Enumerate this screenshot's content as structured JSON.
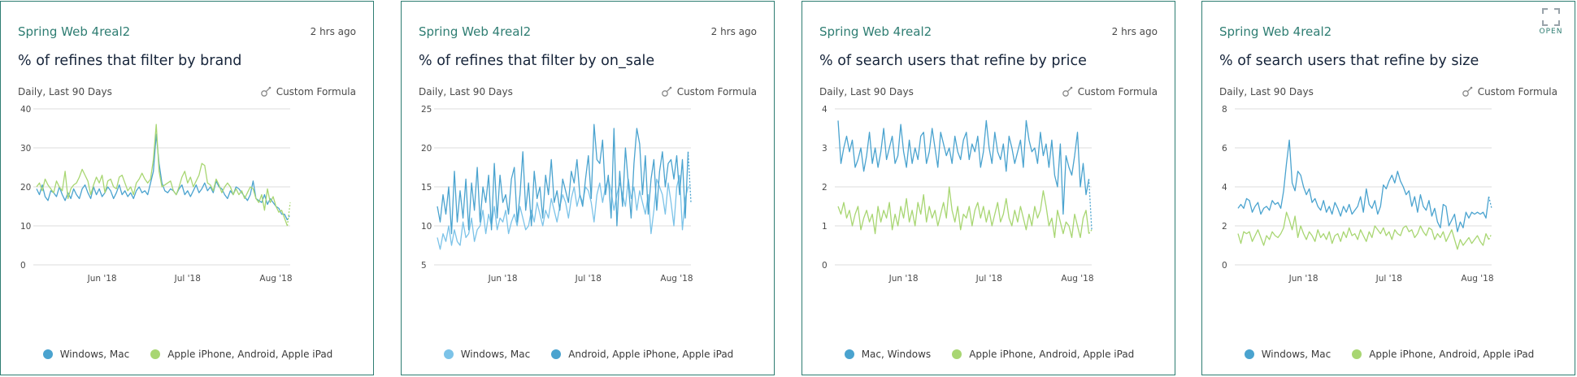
{
  "colors": {
    "blue": "#4aa3cf",
    "green": "#a8d672",
    "border": "#2e7d72"
  },
  "open_label": "OPEN",
  "open_icon": "expand-icon",
  "cards": [
    {
      "source": "Spring Web 4real2",
      "age": "2 hrs ago",
      "title": "% of refines that filter by brand",
      "range": "Daily, Last 90 Days",
      "formula_label": "Custom Formula",
      "formula_icon": "formula-icon",
      "legend": [
        {
          "label": "Windows, Mac",
          "color": "#4aa3cf"
        },
        {
          "label": "Apple iPhone, Android, Apple iPad",
          "color": "#a8d672"
        }
      ],
      "chart_data": {
        "type": "line",
        "ylim": [
          0,
          40
        ],
        "yticks": [
          "0",
          "10",
          "20",
          "30",
          "40"
        ],
        "xticks": [
          {
            "label": "Jun '18",
            "day": 23
          },
          {
            "label": "Jul '18",
            "day": 53
          },
          {
            "label": "Aug '18",
            "day": 84
          }
        ],
        "series": [
          {
            "name": "Windows, Mac",
            "color": "#4aa3cf",
            "values": [
              19.5,
              18.0,
              20.5,
              17.5,
              16.5,
              19.0,
              18.5,
              17.5,
              20.0,
              18.0,
              16.5,
              18.5,
              17.0,
              19.5,
              18.0,
              17.0,
              19.5,
              20.5,
              18.5,
              17.0,
              20.0,
              18.0,
              19.5,
              17.5,
              18.5,
              20.0,
              19.0,
              17.0,
              18.5,
              20.5,
              18.0,
              19.0,
              17.5,
              18.5,
              17.0,
              19.0,
              20.0,
              18.5,
              19.0,
              18.0,
              21.0,
              24.0,
              33.5,
              26.0,
              21.0,
              19.0,
              18.5,
              19.5,
              19.0,
              18.0,
              19.5,
              20.5,
              18.0,
              19.0,
              17.5,
              19.0,
              20.5,
              18.5,
              19.5,
              21.0,
              19.0,
              20.0,
              18.5,
              21.5,
              20.0,
              19.5,
              18.0,
              17.0,
              19.0,
              18.0,
              20.0,
              19.5,
              18.5,
              17.5,
              16.5,
              18.0,
              21.5,
              17.0,
              16.5,
              16.0,
              18.0,
              15.5,
              17.0,
              16.0,
              15.0,
              14.5,
              13.0,
              13.0,
              11.5,
              13.0
            ]
          },
          {
            "name": "Apple iPhone, Android, Apple iPad",
            "color": "#a8d672",
            "values": [
              20.0,
              21.0,
              19.0,
              22.0,
              20.5,
              19.5,
              18.5,
              21.5,
              20.0,
              19.0,
              24.0,
              17.0,
              19.5,
              20.5,
              21.0,
              22.5,
              24.5,
              23.0,
              21.5,
              18.0,
              20.5,
              22.5,
              21.0,
              23.0,
              18.5,
              21.5,
              22.0,
              20.0,
              19.5,
              22.5,
              23.0,
              21.0,
              19.0,
              20.0,
              18.0,
              21.0,
              22.0,
              23.5,
              22.0,
              21.0,
              22.0,
              27.0,
              36.0,
              24.0,
              20.0,
              20.5,
              21.0,
              21.5,
              19.0,
              18.0,
              20.0,
              22.5,
              24.0,
              21.0,
              22.5,
              20.0,
              21.5,
              23.0,
              26.0,
              25.5,
              21.0,
              20.5,
              19.0,
              22.0,
              20.5,
              18.5,
              20.0,
              21.0,
              20.0,
              18.0,
              19.5,
              18.0,
              19.0,
              17.0,
              18.5,
              20.0,
              19.5,
              17.0,
              16.0,
              18.0,
              14.0,
              19.5,
              16.0,
              17.5,
              15.0,
              13.5,
              14.0,
              12.0,
              10.0,
              16.0
            ]
          }
        ]
      }
    },
    {
      "source": "Spring Web 4real2",
      "age": "2 hrs ago",
      "title": "% of refines that filter by on_sale",
      "range": "Daily, Last 90 Days",
      "formula_label": "Custom Formula",
      "formula_icon": "formula-icon",
      "legend": [
        {
          "label": "Windows, Mac",
          "color": "#7cc3e8"
        },
        {
          "label": "Android, Apple iPhone, Apple iPad",
          "color": "#4aa3cf"
        }
      ],
      "chart_data": {
        "type": "line",
        "ylim": [
          5,
          25
        ],
        "yticks": [
          "5",
          "10",
          "15",
          "20",
          "25"
        ],
        "xticks": [
          {
            "label": "Jun '18",
            "day": 23
          },
          {
            "label": "Jul '18",
            "day": 53
          },
          {
            "label": "Aug '18",
            "day": 84
          }
        ],
        "series": [
          {
            "name": "Windows, Mac",
            "color": "#7cc3e8",
            "values": [
              8.5,
              7.0,
              9.0,
              8.0,
              10.0,
              7.5,
              9.5,
              8.0,
              7.5,
              10.5,
              8.5,
              9.0,
              11.0,
              8.0,
              9.5,
              10.0,
              12.0,
              9.0,
              11.5,
              10.0,
              12.5,
              9.5,
              11.0,
              10.5,
              12.0,
              9.0,
              10.5,
              11.5,
              10.0,
              12.5,
              11.0,
              9.5,
              10.0,
              12.0,
              10.5,
              13.0,
              11.5,
              10.0,
              12.0,
              11.0,
              13.5,
              12.0,
              10.5,
              12.5,
              14.0,
              13.0,
              11.0,
              13.5,
              15.0,
              12.5,
              14.0,
              13.0,
              15.0,
              14.5,
              13.0,
              10.5,
              14.0,
              15.5,
              13.0,
              15.0,
              16.0,
              14.5,
              12.0,
              14.0,
              15.5,
              14.0,
              12.5,
              16.0,
              13.5,
              15.0,
              12.0,
              14.5,
              13.0,
              11.5,
              14.0,
              9.0,
              12.0,
              16.0,
              15.0,
              14.0,
              11.5,
              15.5,
              13.0,
              10.0,
              15.0,
              16.5,
              9.5,
              13.5,
              15.0,
              15.0
            ]
          },
          {
            "name": "Android, Apple iPhone, Apple iPad",
            "color": "#4aa3cf",
            "values": [
              12.5,
              10.5,
              14.0,
              11.5,
              15.0,
              9.0,
              17.0,
              10.5,
              14.5,
              11.0,
              16.0,
              9.5,
              15.5,
              12.0,
              17.5,
              10.5,
              15.0,
              13.0,
              16.5,
              9.5,
              18.0,
              11.0,
              16.5,
              13.0,
              14.0,
              11.5,
              16.0,
              17.5,
              10.5,
              14.0,
              19.5,
              12.0,
              15.5,
              10.0,
              17.0,
              13.5,
              15.0,
              11.0,
              16.5,
              14.0,
              18.5,
              13.0,
              14.5,
              12.0,
              16.0,
              14.5,
              13.0,
              17.0,
              15.5,
              18.5,
              14.0,
              12.5,
              16.0,
              19.0,
              13.5,
              23.0,
              18.5,
              18.0,
              21.0,
              14.0,
              16.5,
              11.0,
              22.5,
              10.0,
              17.0,
              12.5,
              20.0,
              15.5,
              11.0,
              18.0,
              22.5,
              20.5,
              14.0,
              19.0,
              11.5,
              16.0,
              18.5,
              12.0,
              17.0,
              19.5,
              15.0,
              18.0,
              18.5,
              16.0,
              19.0,
              14.0,
              18.5,
              11.0,
              19.5,
              13.0
            ]
          }
        ]
      }
    },
    {
      "source": "Spring Web 4real2",
      "age": "2 hrs ago",
      "title": "% of search users that refine by price",
      "range": "Daily, Last 90 Days",
      "formula_label": "Custom Formula",
      "formula_icon": "formula-icon",
      "legend": [
        {
          "label": "Mac, Windows",
          "color": "#4aa3cf"
        },
        {
          "label": "Apple iPhone, Android, Apple iPad",
          "color": "#a8d672"
        }
      ],
      "chart_data": {
        "type": "line",
        "ylim": [
          0,
          4
        ],
        "yticks": [
          "0",
          "1",
          "2",
          "3",
          "4"
        ],
        "xticks": [
          {
            "label": "Jun '18",
            "day": 23
          },
          {
            "label": "Jul '18",
            "day": 53
          },
          {
            "label": "Aug '18",
            "day": 84
          }
        ],
        "series": [
          {
            "name": "Mac, Windows",
            "color": "#4aa3cf",
            "values": [
              3.7,
              2.6,
              3.0,
              3.3,
              2.9,
              3.2,
              2.5,
              2.7,
              3.0,
              2.4,
              2.8,
              3.4,
              2.6,
              3.0,
              2.5,
              2.9,
              3.5,
              2.7,
              3.0,
              3.3,
              2.6,
              2.8,
              3.6,
              2.9,
              2.5,
              3.2,
              2.6,
              3.0,
              2.7,
              3.3,
              3.4,
              2.6,
              2.9,
              3.5,
              3.0,
              2.5,
              3.4,
              3.1,
              2.8,
              3.0,
              2.6,
              3.3,
              2.9,
              2.7,
              3.2,
              3.4,
              2.7,
              3.1,
              2.9,
              3.3,
              2.5,
              2.9,
              3.7,
              3.0,
              2.6,
              3.4,
              2.9,
              2.7,
              3.1,
              2.4,
              3.3,
              3.0,
              2.6,
              2.9,
              3.2,
              2.5,
              3.7,
              3.2,
              2.9,
              3.0,
              2.6,
              3.4,
              2.8,
              3.1,
              2.5,
              3.2,
              2.3,
              2.0,
              3.1,
              1.3,
              2.8,
              2.5,
              2.3,
              2.8,
              3.4,
              2.0,
              2.6,
              1.8,
              2.2,
              0.9
            ]
          },
          {
            "name": "Apple iPhone, Android, Apple iPad",
            "color": "#a8d672",
            "values": [
              1.5,
              1.3,
              1.6,
              1.2,
              1.4,
              1.0,
              1.3,
              1.5,
              0.9,
              1.2,
              1.4,
              1.1,
              1.3,
              0.8,
              1.5,
              1.1,
              1.4,
              1.2,
              1.6,
              0.9,
              1.3,
              1.0,
              1.5,
              1.2,
              1.7,
              1.1,
              1.4,
              1.0,
              1.6,
              1.3,
              1.8,
              1.1,
              1.5,
              1.2,
              1.4,
              1.0,
              1.3,
              1.6,
              1.2,
              2.0,
              1.4,
              1.1,
              1.5,
              0.9,
              1.3,
              1.2,
              1.5,
              1.0,
              1.4,
              1.6,
              1.2,
              1.5,
              1.1,
              1.4,
              1.0,
              1.3,
              1.6,
              1.1,
              1.3,
              1.7,
              1.2,
              1.0,
              1.4,
              1.1,
              1.5,
              1.2,
              0.9,
              1.3,
              1.0,
              1.5,
              1.2,
              1.4,
              1.9,
              1.5,
              1.0,
              1.2,
              0.7,
              1.4,
              1.1,
              0.8,
              1.1,
              1.0,
              0.7,
              1.3,
              1.0,
              0.7,
              1.2,
              1.4,
              0.8,
              0.9
            ]
          }
        ]
      }
    },
    {
      "source": "Spring Web 4real2",
      "age": "",
      "title": "% of search users that refine by size",
      "range": "Daily, Last 90 Days",
      "formula_label": "Custom Formula",
      "formula_icon": "formula-icon",
      "legend": [
        {
          "label": "Windows, Mac",
          "color": "#4aa3cf"
        },
        {
          "label": "Apple iPhone, Android, Apple iPad",
          "color": "#a8d672"
        }
      ],
      "chart_data": {
        "type": "line",
        "ylim": [
          0,
          8
        ],
        "yticks": [
          "0",
          "2",
          "4",
          "6",
          "8"
        ],
        "xticks": [
          {
            "label": "Jun '18",
            "day": 23
          },
          {
            "label": "Jul '18",
            "day": 53
          },
          {
            "label": "Aug '18",
            "day": 84
          }
        ],
        "series": [
          {
            "name": "Windows, Mac",
            "color": "#4aa3cf",
            "values": [
              2.9,
              3.1,
              2.9,
              3.4,
              3.3,
              2.7,
              3.0,
              3.2,
              2.6,
              2.9,
              3.0,
              2.8,
              3.3,
              3.1,
              3.2,
              2.9,
              3.8,
              5.2,
              6.4,
              4.2,
              3.8,
              4.8,
              4.6,
              4.0,
              3.6,
              3.9,
              3.2,
              3.4,
              3.0,
              2.8,
              3.3,
              2.7,
              3.0,
              2.6,
              3.2,
              2.9,
              2.5,
              3.0,
              2.7,
              3.1,
              2.6,
              2.8,
              3.0,
              3.5,
              2.7,
              3.9,
              3.1,
              2.9,
              3.3,
              2.6,
              3.0,
              4.1,
              3.9,
              4.3,
              4.6,
              4.2,
              4.8,
              4.3,
              4.0,
              3.6,
              3.8,
              3.0,
              3.5,
              2.7,
              3.6,
              3.0,
              2.8,
              3.3,
              2.5,
              2.9,
              2.2,
              1.9,
              3.1,
              3.0,
              2.0,
              2.3,
              2.6,
              1.7,
              2.2,
              1.9,
              2.7,
              2.4,
              2.7,
              2.6,
              2.7,
              2.6,
              2.7,
              2.4,
              3.5,
              2.9
            ]
          },
          {
            "name": "Apple iPhone, Android, Apple iPad",
            "color": "#a8d672",
            "values": [
              1.6,
              1.1,
              1.7,
              1.6,
              1.7,
              1.2,
              1.5,
              1.8,
              1.4,
              1.0,
              1.5,
              1.3,
              1.7,
              1.5,
              1.4,
              1.6,
              1.9,
              2.7,
              2.3,
              1.8,
              2.5,
              1.4,
              2.0,
              1.6,
              1.3,
              1.7,
              1.5,
              1.2,
              1.8,
              1.4,
              1.6,
              1.3,
              1.7,
              1.1,
              1.5,
              1.6,
              1.2,
              1.7,
              1.4,
              1.9,
              1.5,
              1.6,
              1.3,
              1.8,
              1.5,
              1.2,
              1.7,
              1.4,
              2.0,
              1.8,
              1.6,
              1.9,
              1.5,
              1.7,
              1.3,
              1.8,
              1.6,
              1.5,
              1.9,
              2.0,
              1.7,
              1.8,
              1.4,
              1.6,
              2.0,
              1.7,
              1.5,
              1.9,
              1.8,
              1.3,
              1.6,
              1.4,
              1.7,
              1.2,
              1.5,
              1.8,
              1.3,
              0.8,
              1.3,
              1.0,
              1.2,
              1.4,
              1.1,
              1.3,
              1.5,
              1.2,
              1.0,
              1.6,
              1.3,
              1.6
            ]
          }
        ]
      }
    }
  ]
}
